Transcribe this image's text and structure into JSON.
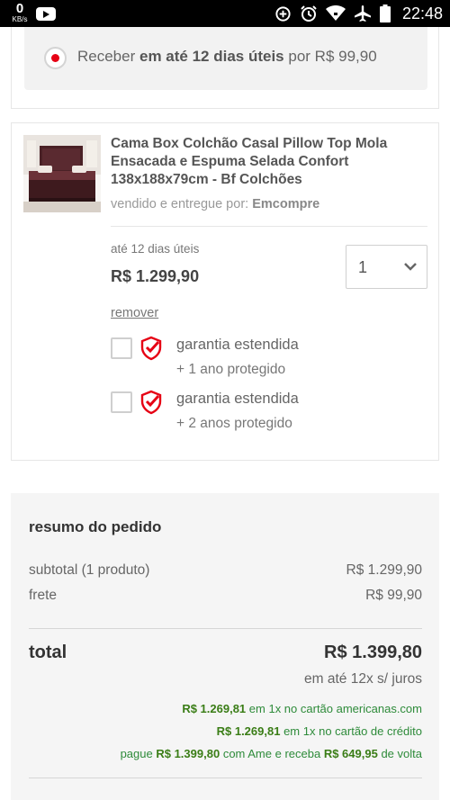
{
  "status_bar": {
    "data_rate": "0",
    "data_unit": "KB/s",
    "time": "22:48",
    "icons": [
      "youtube-icon",
      "data-saver-icon",
      "alarm-icon",
      "wifi-icon",
      "airplane-icon",
      "battery-icon"
    ]
  },
  "delivery": {
    "prefix": "Receber",
    "highlight": "em até 12 dias úteis",
    "suffix": "por R$ 99,90",
    "selected": true
  },
  "product": {
    "title": "Cama Box Colchão Casal Pillow Top Mola Ensacada e Espuma Selada Confort 138x188x79cm - Bf Colchões",
    "seller_label": "vendido e entregue por:",
    "seller_name": "Emcompre",
    "deadline": "até 12 dias úteis",
    "price": "R$ 1.299,90",
    "quantity": "1",
    "remove_label": "remover",
    "warranties": [
      {
        "title": "garantia estendida",
        "subtitle": "+ 1 ano protegido",
        "checked": false
      },
      {
        "title": "garantia estendida",
        "subtitle": "+ 2 anos protegido",
        "checked": false
      }
    ]
  },
  "summary": {
    "title": "resumo do pedido",
    "subtotal_label": "subtotal (1 produto)",
    "subtotal_value": "R$ 1.299,90",
    "shipping_label": "frete",
    "shipping_value": "R$ 99,90",
    "total_label": "total",
    "total_value": "R$ 1.399,80",
    "installments": "em até 12x s/ juros",
    "pay_options": [
      {
        "amount": "R$ 1.269,81",
        "text": "em 1x no cartão americanas.com"
      },
      {
        "amount": "R$ 1.269,81",
        "text": "em 1x no cartão de crédito"
      }
    ],
    "ame": {
      "prefix": "pague",
      "amount": "R$ 1.399,80",
      "middle": "com Ame e receba",
      "cashback": "R$ 649,95",
      "suffix": "de volta"
    }
  },
  "colors": {
    "accent_red": "#e60014",
    "promo_green": "#3a7d16",
    "summary_bg": "#f5f5f5"
  }
}
